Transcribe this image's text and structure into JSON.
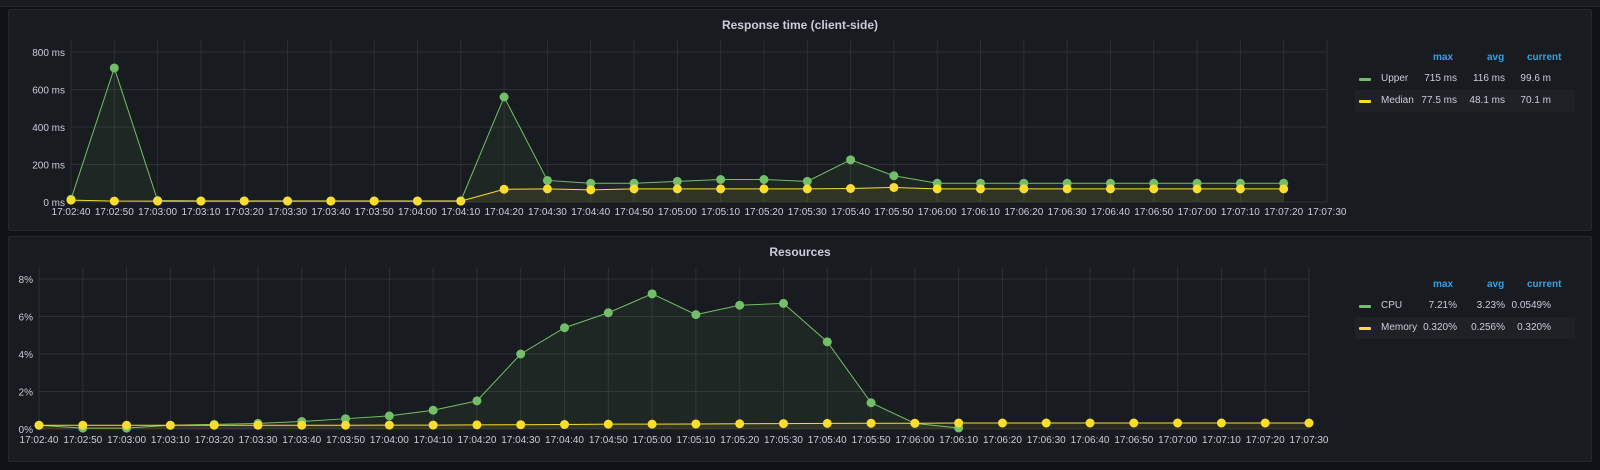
{
  "panels": [
    {
      "title": "Response time (client-side)",
      "legend_headers": {
        "max": "max",
        "avg": "avg",
        "current": "current"
      },
      "legend": [
        {
          "name": "Upper",
          "color": "#73bf69",
          "max": "715 ms",
          "avg": "116 ms",
          "current": "99.6 m"
        },
        {
          "name": "Median",
          "color": "#fade2a",
          "max": "77.5 ms",
          "avg": "48.1 ms",
          "current": "70.1 m"
        }
      ],
      "chart_data": {
        "type": "line",
        "x": [
          "17:02:40",
          "17:02:50",
          "17:03:00",
          "17:03:10",
          "17:03:20",
          "17:03:30",
          "17:03:40",
          "17:03:50",
          "17:04:00",
          "17:04:10",
          "17:04:20",
          "17:04:30",
          "17:04:40",
          "17:04:50",
          "17:05:00",
          "17:05:10",
          "17:05:20",
          "17:05:30",
          "17:05:40",
          "17:05:50",
          "17:06:00",
          "17:06:10",
          "17:06:20",
          "17:06:30",
          "17:06:40",
          "17:06:50",
          "17:07:00",
          "17:07:10",
          "17:07:20"
        ],
        "x_ticks": [
          "17:02:40",
          "17:02:50",
          "17:03:00",
          "17:03:10",
          "17:03:20",
          "17:03:30",
          "17:03:40",
          "17:03:50",
          "17:04:00",
          "17:04:10",
          "17:04:20",
          "17:04:30",
          "17:04:40",
          "17:04:50",
          "17:05:00",
          "17:05:10",
          "17:05:20",
          "17:05:30",
          "17:05:40",
          "17:05:50",
          "17:06:00",
          "17:06:10",
          "17:06:20",
          "17:06:30",
          "17:06:40",
          "17:06:50",
          "17:07:00",
          "17:07:10",
          "17:07:20",
          "17:07:30"
        ],
        "y_ticks": [
          0,
          200,
          400,
          600,
          800
        ],
        "y_tick_labels": [
          "0 ms",
          "200 ms",
          "400 ms",
          "600 ms",
          "800 ms"
        ],
        "ylim": [
          0,
          800
        ],
        "series": [
          {
            "name": "Upper",
            "color": "#73bf69",
            "values": [
              15,
              715,
              8,
              6,
              6,
              6,
              6,
              6,
              6,
              6,
              560,
              115,
              100,
              100,
              110,
              120,
              120,
              110,
              225,
              140,
              100,
              100,
              100,
              100,
              100,
              100,
              100,
              100,
              100
            ]
          },
          {
            "name": "Median",
            "color": "#fade2a",
            "values": [
              10,
              5,
              5,
              5,
              5,
              5,
              5,
              5,
              5,
              5,
              68,
              70,
              65,
              70,
              70,
              70,
              70,
              70,
              72,
              77.5,
              70,
              70,
              70,
              70,
              70,
              70,
              70,
              70,
              70
            ]
          }
        ]
      }
    },
    {
      "title": "Resources",
      "legend_headers": {
        "max": "max",
        "avg": "avg",
        "current": "current"
      },
      "legend": [
        {
          "name": "CPU",
          "color": "#73bf69",
          "max": "7.21%",
          "avg": "3.23%",
          "current": "0.0549%"
        },
        {
          "name": "Memory",
          "color": "#fade2a",
          "max": "0.320%",
          "avg": "0.256%",
          "current": "0.320%"
        }
      ],
      "chart_data": {
        "type": "line",
        "x": [
          "17:02:40",
          "17:02:50",
          "17:03:00",
          "17:03:10",
          "17:03:20",
          "17:03:30",
          "17:03:40",
          "17:03:50",
          "17:04:00",
          "17:04:10",
          "17:04:20",
          "17:04:30",
          "17:04:40",
          "17:04:50",
          "17:05:00",
          "17:05:10",
          "17:05:20",
          "17:05:30",
          "17:05:40",
          "17:05:50",
          "17:06:00",
          "17:06:10"
        ],
        "x_ticks": [
          "17:02:40",
          "17:02:50",
          "17:03:00",
          "17:03:10",
          "17:03:20",
          "17:03:30",
          "17:03:40",
          "17:03:50",
          "17:04:00",
          "17:04:10",
          "17:04:20",
          "17:04:30",
          "17:04:40",
          "17:04:50",
          "17:05:00",
          "17:05:10",
          "17:05:20",
          "17:05:30",
          "17:05:40",
          "17:05:50",
          "17:06:00",
          "17:06:10",
          "17:06:20",
          "17:06:30",
          "17:06:40",
          "17:06:50",
          "17:07:00",
          "17:07:10",
          "17:07:20",
          "17:07:30"
        ],
        "y_ticks": [
          0,
          2,
          4,
          6,
          8
        ],
        "y_tick_labels": [
          "0%",
          "2%",
          "4%",
          "6%",
          "8%"
        ],
        "ylim": [
          0,
          8
        ],
        "series": [
          {
            "name": "CPU",
            "color": "#73bf69",
            "values": [
              0.2,
              0.05,
              0.05,
              0.2,
              0.25,
              0.3,
              0.4,
              0.55,
              0.7,
              1.0,
              1.5,
              4.0,
              5.4,
              6.2,
              7.21,
              6.1,
              6.6,
              6.7,
              4.65,
              1.4,
              0.3,
              0.0549
            ]
          },
          {
            "name": "Memory",
            "color": "#fade2a",
            "x": [
              "17:02:40",
              "17:02:50",
              "17:03:00",
              "17:03:10",
              "17:03:20",
              "17:03:30",
              "17:03:40",
              "17:03:50",
              "17:04:00",
              "17:04:10",
              "17:04:20",
              "17:04:30",
              "17:04:40",
              "17:04:50",
              "17:05:00",
              "17:05:10",
              "17:05:20",
              "17:05:30",
              "17:05:40",
              "17:05:50",
              "17:06:00",
              "17:06:10",
              "17:06:20",
              "17:06:30",
              "17:06:40",
              "17:06:50",
              "17:07:00",
              "17:07:10",
              "17:07:20",
              "17:07:30"
            ],
            "values": [
              0.2,
              0.2,
              0.2,
              0.2,
              0.2,
              0.2,
              0.2,
              0.2,
              0.21,
              0.21,
              0.22,
              0.23,
              0.24,
              0.26,
              0.26,
              0.27,
              0.28,
              0.29,
              0.3,
              0.31,
              0.31,
              0.32,
              0.32,
              0.32,
              0.32,
              0.32,
              0.32,
              0.32,
              0.32,
              0.32
            ]
          }
        ]
      }
    }
  ]
}
